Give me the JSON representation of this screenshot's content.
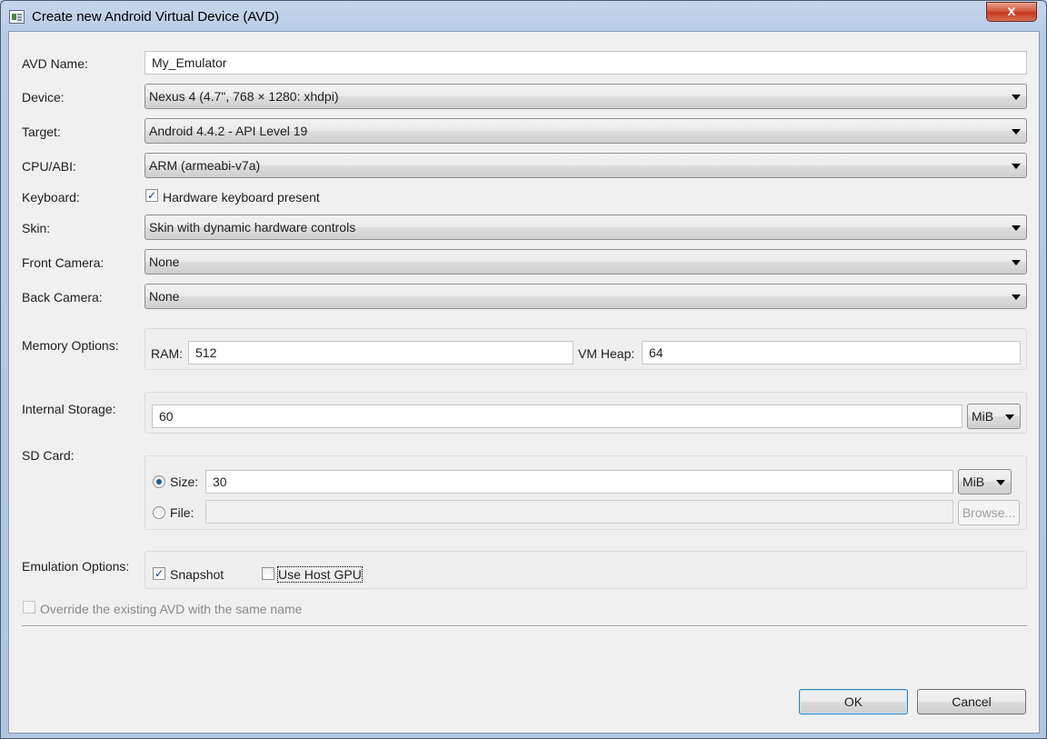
{
  "window": {
    "title": "Create new Android Virtual Device (AVD)",
    "close_glyph": "x"
  },
  "form": {
    "avd_name": {
      "label": "AVD Name:",
      "value": "My_Emulator"
    },
    "device": {
      "label": "Device:",
      "value": "Nexus 4 (4.7\", 768 × 1280: xhdpi)"
    },
    "target": {
      "label": "Target:",
      "value": "Android 4.4.2 - API Level 19"
    },
    "cpu_abi": {
      "label": "CPU/ABI:",
      "value": "ARM (armeabi-v7a)"
    },
    "keyboard": {
      "label": "Keyboard:",
      "checkbox_label": "Hardware keyboard present",
      "checked": true
    },
    "skin": {
      "label": "Skin:",
      "value": "Skin with dynamic hardware controls"
    },
    "front_camera": {
      "label": "Front Camera:",
      "value": "None"
    },
    "back_camera": {
      "label": "Back Camera:",
      "value": "None"
    },
    "memory": {
      "label": "Memory Options:",
      "ram_label": "RAM:",
      "ram_value": "512",
      "vm_heap_label": "VM Heap:",
      "vm_heap_value": "64"
    },
    "internal_storage": {
      "label": "Internal Storage:",
      "value": "60",
      "unit": "MiB"
    },
    "sd_card": {
      "label": "SD Card:",
      "size_label": "Size:",
      "size_value": "30",
      "size_unit": "MiB",
      "size_selected": true,
      "file_label": "File:",
      "file_value": "",
      "browse_label": "Browse..."
    },
    "emulation": {
      "label": "Emulation Options:",
      "snapshot_label": "Snapshot",
      "snapshot_checked": true,
      "host_gpu_label": "Use Host GPU",
      "host_gpu_checked": false
    },
    "override": {
      "label": "Override the existing AVD with the same name",
      "checked": false,
      "disabled": true
    }
  },
  "buttons": {
    "ok": "OK",
    "cancel": "Cancel"
  },
  "glyphs": {
    "check": "✓"
  }
}
